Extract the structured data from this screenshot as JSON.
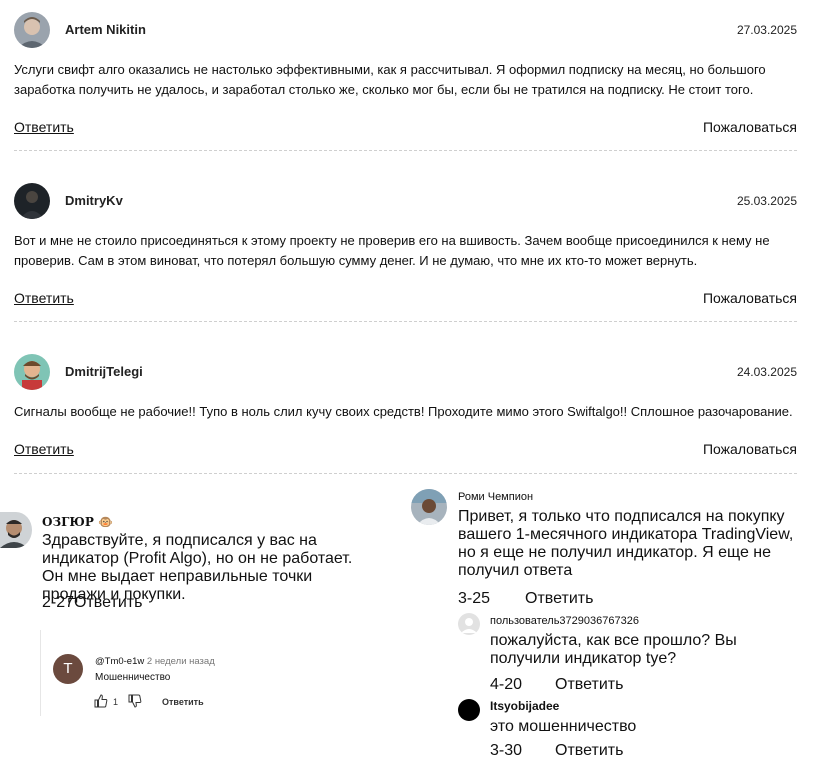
{
  "reviews": [
    {
      "author": "Artem Nikitin",
      "date": "27.03.2025",
      "text": "Услуги свифт алго оказались не настолько эффективными, как я рассчитывал. Я оформил подписку на месяц, но большого заработка получить не удалось, и заработал столько же, сколько мог бы, если бы не тратился на подписку. Не стоит того.",
      "reply_label": "Ответить",
      "report_label": "Пожаловаться"
    },
    {
      "author": "DmitryKv",
      "date": "25.03.2025",
      "text": "Вот и мне не стоило присоединяться к этому проекту не проверив его на вшивость. Зачем вообще присоединился к нему не проверив. Сам в этом виноват, что потерял большую сумму денег. И не думаю, что мне их кто-то может вернуть.",
      "reply_label": "Ответить",
      "report_label": "Пожаловаться"
    },
    {
      "author": "DmitrijTelegi",
      "date": "24.03.2025",
      "text": "Сигналы вообще не рабочие!! Тупо в ноль слил кучу своих средств! Проходите мимо этого Swiftalgo!! Сплошное разочарование.",
      "reply_label": "Ответить",
      "report_label": "Пожаловаться"
    }
  ],
  "left_thread": {
    "author": "ОЗГЮР",
    "author_emoji": "🐵",
    "text": "Здравствуйте, я подписался у вас на индикатор (Profit Algo), но он не работает. Он мне выдает неправильные точки продажи и покупки.",
    "time": "2-27",
    "reply_label": "Ответить",
    "nested": {
      "avatar_letter": "T",
      "handle": "@Tm0-e1w",
      "ago": "2 недели назад",
      "text": "Мошенничество",
      "likes": "1",
      "reply_label": "Ответить"
    }
  },
  "right_thread": {
    "author": "Роми Чемпион",
    "text": "Привет, я только что подписался на покупку вашего 1-месячного индикатора TradingView, но я еще не получил индикатор. Я еще не получил ответа",
    "time": "3-25",
    "reply_label": "Ответить",
    "replies": [
      {
        "author": "пользователь3729036767326",
        "text": "пожалуйста, как все прошло? Вы получили индикатор tye?",
        "time": "4-20",
        "reply_label": "Ответить"
      },
      {
        "author": "Itsyobijadee",
        "text": "это мошенничество",
        "time": "3-30",
        "reply_label": "Ответить"
      }
    ]
  },
  "colors": {
    "divider": "#cfcfcf",
    "meta_text": "#777777",
    "nested_avatar": "#6b4a3e"
  }
}
